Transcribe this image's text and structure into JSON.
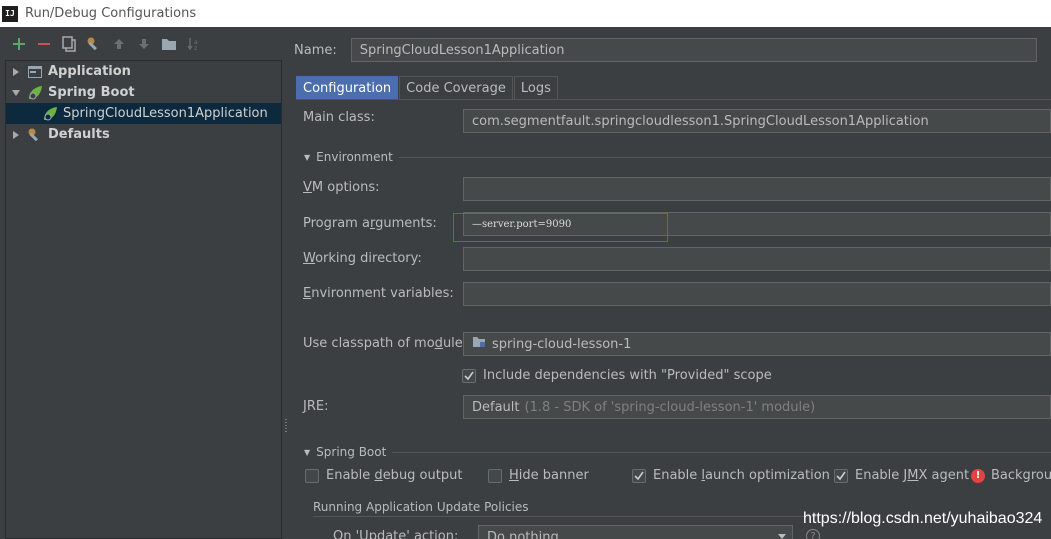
{
  "window": {
    "title": "Run/Debug Configurations",
    "logo_text": "IJ"
  },
  "toolbar": {
    "icons": [
      "add-icon",
      "remove-icon",
      "copy-icon",
      "wrench-icon",
      "move-up-icon",
      "move-down-icon",
      "folder-icon",
      "sort-icon"
    ]
  },
  "tree": {
    "items": [
      {
        "label": "Application"
      },
      {
        "label": "Spring Boot"
      },
      {
        "label": "SpringCloudLesson1Application"
      },
      {
        "label": "Defaults"
      }
    ]
  },
  "form": {
    "name_label": "Name:",
    "name_value": "SpringCloudLesson1Application",
    "tabs": [
      "Configuration",
      "Code Coverage",
      "Logs"
    ],
    "main_class_label": "Main class:",
    "main_class_value": "com.segmentfault.springcloudlesson1.SpringCloudLesson1Application",
    "environment_section": "Environment",
    "vm_options_label": "VM options:",
    "vm_options_value": "",
    "program_args_label": "Program arguments:",
    "program_args_value": "—server.port=9090",
    "working_dir_label": "Working directory:",
    "working_dir_value": "",
    "env_vars_label": "Environment variables:",
    "env_vars_value": "",
    "classpath_label": "Use classpath of module:",
    "classpath_value": "spring-cloud-lesson-1",
    "include_deps_label": "Include dependencies with \"Provided\" scope",
    "jre_label": "JRE:",
    "jre_default": "Default",
    "jre_detail": "(1.8 - SDK of 'spring-cloud-lesson-1' module)",
    "spring_boot_section": "Spring Boot",
    "enable_debug_label": "Enable debug output",
    "hide_banner_label": "Hide banner",
    "launch_opt_label": "Enable launch optimization",
    "jmx_label": "Enable JMX agent",
    "background_label": "Backgroun",
    "update_policies_label": "Running Application Update Policies",
    "update_action_label": "On 'Update' action:",
    "update_action_value": "Do nothing"
  },
  "checkboxes": {
    "include_deps": true,
    "enable_debug": false,
    "hide_banner": false,
    "launch_opt": true,
    "jmx": true
  },
  "watermark": "https://blog.csdn.net/yuhaibao324",
  "colors": {
    "accent": "#4b6eaf",
    "selection": "#0d293e",
    "highlight_box": "#d93636",
    "add": "#59a869",
    "remove": "#c75450"
  }
}
